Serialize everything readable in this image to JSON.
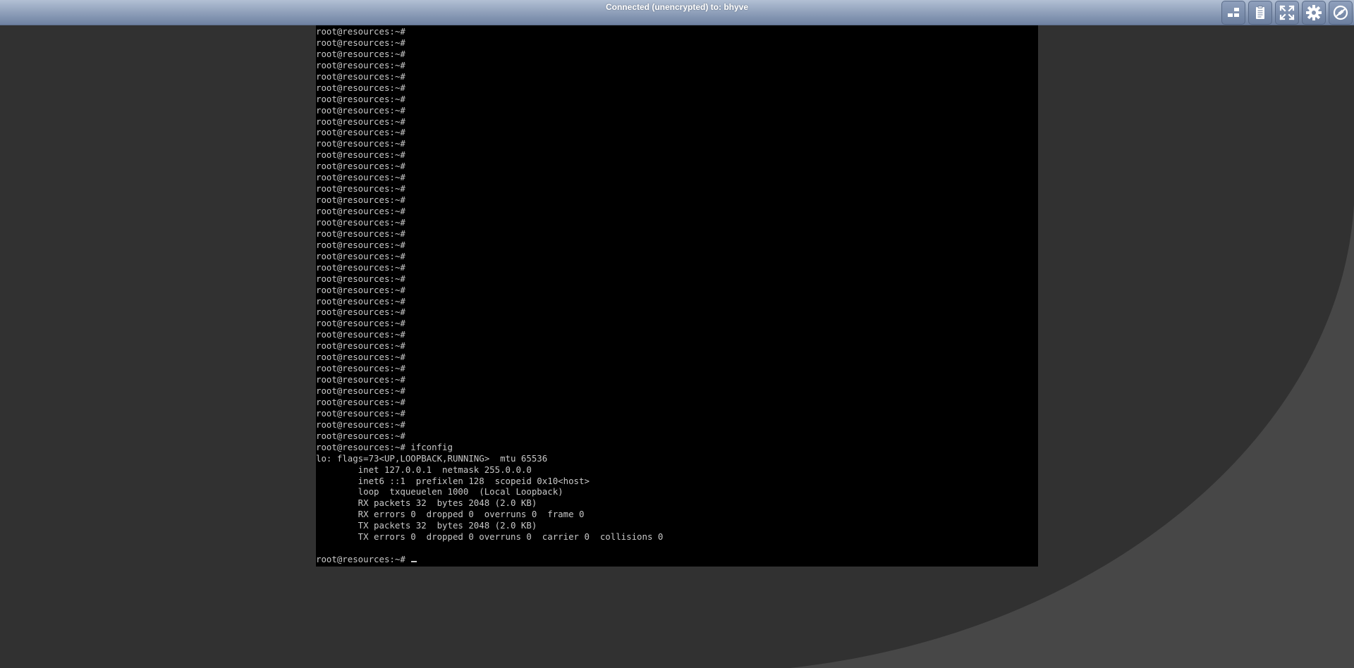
{
  "status": {
    "connection_text": "Connected (unencrypted) to: bhyve"
  },
  "toolbar": {
    "buttons": [
      {
        "name": "send-keys-button",
        "icon": "keyboard-keys-icon"
      },
      {
        "name": "clipboard-button",
        "icon": "clipboard-icon"
      },
      {
        "name": "fullscreen-button",
        "icon": "fullscreen-icon"
      },
      {
        "name": "settings-button",
        "icon": "gear-icon"
      },
      {
        "name": "disconnect-button",
        "icon": "disconnect-icon"
      }
    ]
  },
  "colors": {
    "background": "#313131",
    "swoosh": "#474747",
    "terminal_bg": "#000000",
    "terminal_fg": "#c8c8c8",
    "status_bar_top": "#b2c0d4",
    "status_bar_bottom": "#6f82a2"
  },
  "terminal": {
    "lines": [
      "root@resources:~#",
      "root@resources:~#",
      "root@resources:~#",
      "root@resources:~#",
      "root@resources:~#",
      "root@resources:~#",
      "root@resources:~#",
      "root@resources:~#",
      "root@resources:~#",
      "root@resources:~#",
      "root@resources:~#",
      "root@resources:~#",
      "root@resources:~#",
      "root@resources:~#",
      "root@resources:~#",
      "root@resources:~#",
      "root@resources:~#",
      "root@resources:~#",
      "root@resources:~#",
      "root@resources:~#",
      "root@resources:~#",
      "root@resources:~#",
      "root@resources:~#",
      "root@resources:~#",
      "root@resources:~#",
      "root@resources:~#",
      "root@resources:~#",
      "root@resources:~#",
      "root@resources:~#",
      "root@resources:~#",
      "root@resources:~#",
      "root@resources:~#",
      "root@resources:~#",
      "root@resources:~#",
      "root@resources:~#",
      "root@resources:~#",
      "root@resources:~#",
      "root@resources:~# ifconfig",
      "lo: flags=73<UP,LOOPBACK,RUNNING>  mtu 65536",
      "        inet 127.0.0.1  netmask 255.0.0.0",
      "        inet6 ::1  prefixlen 128  scopeid 0x10<host>",
      "        loop  txqueuelen 1000  (Local Loopback)",
      "        RX packets 32  bytes 2048 (2.0 KB)",
      "        RX errors 0  dropped 0  overruns 0  frame 0",
      "        TX packets 32  bytes 2048 (2.0 KB)",
      "        TX errors 0  dropped 0 overruns 0  carrier 0  collisions 0",
      ""
    ],
    "prompt": "root@resources:~# "
  }
}
